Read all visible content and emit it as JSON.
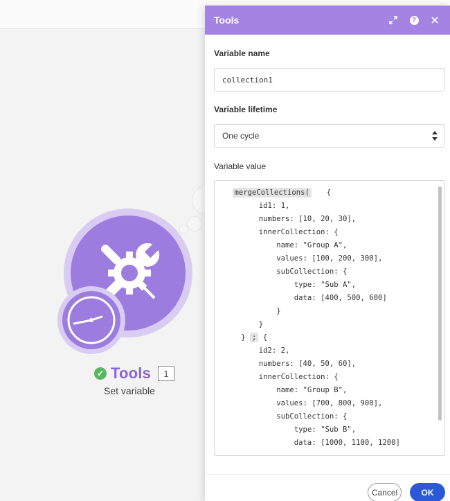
{
  "module": {
    "title": "Tools",
    "badge": "1",
    "subtitle": "Set variable",
    "icon": "wrench-screwdriver-gear-icon",
    "colors": {
      "accent": "#9d7ce0",
      "title": "#8a66d6",
      "status_ok": "#57b85f"
    }
  },
  "panel": {
    "title": "Tools",
    "header_icons": [
      "expand-icon",
      "help-icon",
      "close-icon"
    ],
    "variable_name": {
      "label": "Variable name",
      "value": "collection1"
    },
    "variable_lifetime": {
      "label": "Variable lifetime",
      "value": "One cycle"
    },
    "variable_value": {
      "label": "Variable value",
      "lines": [
        {
          "indent": "",
          "token": "mergeCollections(",
          "after": "  {"
        },
        {
          "indent": "      ",
          "text": "id1: 1,"
        },
        {
          "indent": "      ",
          "text": "numbers: [10, 20, 30],"
        },
        {
          "indent": "      ",
          "text": "innerCollection: {"
        },
        {
          "indent": "          ",
          "text": "name: \"Group A\","
        },
        {
          "indent": "          ",
          "text": "values: [100, 200, 300],"
        },
        {
          "indent": "          ",
          "text": "subCollection: {"
        },
        {
          "indent": "              ",
          "text": "type: \"Sub A\","
        },
        {
          "indent": "              ",
          "text": "data: [400, 500, 600]"
        },
        {
          "indent": "          ",
          "text": "}"
        },
        {
          "indent": "      ",
          "text": "}"
        },
        {
          "indent": "  ",
          "text": "} ",
          "token": ";",
          "after": " {"
        },
        {
          "indent": "      ",
          "text": "id2: 2,"
        },
        {
          "indent": "      ",
          "text": "numbers: [40, 50, 60],"
        },
        {
          "indent": "      ",
          "text": "innerCollection: {"
        },
        {
          "indent": "          ",
          "text": "name: \"Group B\","
        },
        {
          "indent": "          ",
          "text": "values: [700, 800, 900],"
        },
        {
          "indent": "          ",
          "text": "subCollection: {"
        },
        {
          "indent": "              ",
          "text": "type: \"Sub B\","
        },
        {
          "indent": "              ",
          "text": "data: [1000, 1100, 1200]"
        }
      ]
    },
    "buttons": {
      "cancel": "Cancel",
      "ok": "OK"
    },
    "colors": {
      "header": "#a583e2",
      "primary_button": "#2a59d8"
    }
  }
}
